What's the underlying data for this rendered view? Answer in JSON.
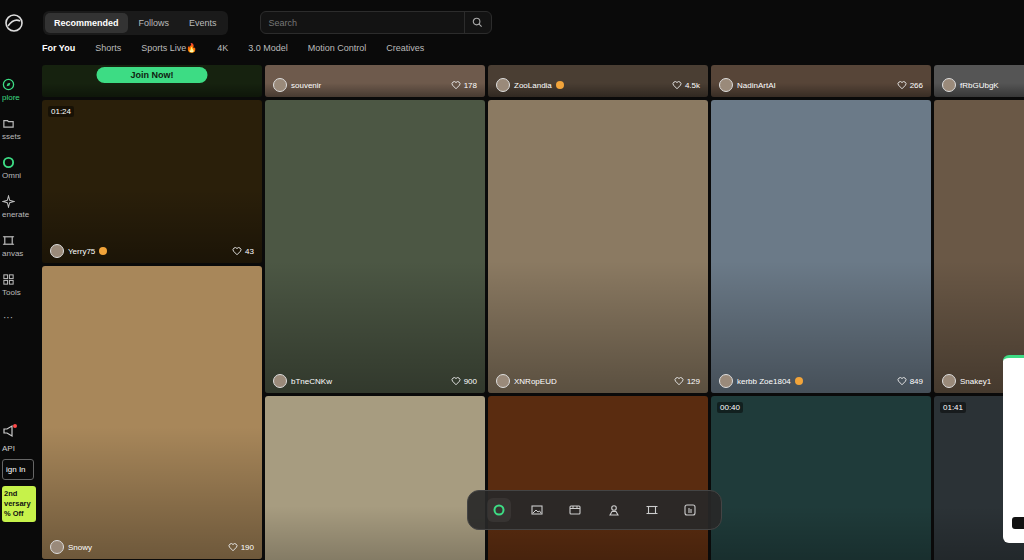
{
  "sidebar": {
    "items": [
      {
        "label": "plore",
        "selected": true
      },
      {
        "label": "ssets",
        "selected": false
      },
      {
        "label": "Omni",
        "selected": false
      },
      {
        "label": "enerate",
        "selected": false
      },
      {
        "label": "anvas",
        "selected": false
      },
      {
        "label": "Tools",
        "selected": false
      }
    ],
    "more": "···",
    "api": "API",
    "sign_in": "ign In",
    "promo": [
      "2nd",
      "versary",
      "% Off"
    ]
  },
  "tabs": [
    {
      "label": "Recommended",
      "selected": true
    },
    {
      "label": "Follows",
      "selected": false
    },
    {
      "label": "Events",
      "selected": false
    }
  ],
  "search": {
    "placeholder": "Search"
  },
  "categories": [
    {
      "label": "For You",
      "selected": true
    },
    {
      "label": "Shorts",
      "selected": false
    },
    {
      "label": "Sports Live🔥",
      "selected": false
    },
    {
      "label": "4K",
      "selected": false
    },
    {
      "label": "3.0 Model",
      "selected": false
    },
    {
      "label": "Motion Control",
      "selected": false
    },
    {
      "label": "Creatives",
      "selected": false
    }
  ],
  "columns": [
    {
      "cards": [
        {
          "kind": "top",
          "color": "#16220f",
          "button": "Join Now!",
          "verified": false
        },
        {
          "kind": "wide",
          "color": "#2a1f0a",
          "duration": "01:24",
          "user": "Yerry75",
          "verified": true,
          "likes": "43"
        },
        {
          "kind": "tall",
          "color": "#a8875a",
          "user": "Snowy",
          "verified": false,
          "likes": "190"
        }
      ]
    },
    {
      "cards": [
        {
          "kind": "top",
          "color": "#6e5a4c",
          "user": "souvenir",
          "verified": false,
          "likes": "178"
        },
        {
          "kind": "tall",
          "color": "#4c5744",
          "user": "bTneCNKw",
          "verified": false,
          "likes": "900"
        },
        {
          "kind": "bottom",
          "color": "#a79c80",
          "verified": false
        }
      ]
    },
    {
      "cards": [
        {
          "kind": "top",
          "color": "#4a3e33",
          "user": "ZooLandia",
          "verified": true,
          "likes": "4.5k"
        },
        {
          "kind": "tall",
          "color": "#8b7a62",
          "user": "XNRopEUD",
          "verified": false,
          "likes": "129"
        },
        {
          "kind": "bottom",
          "color": "#5a2c10",
          "verified": false
        }
      ]
    },
    {
      "cards": [
        {
          "kind": "top",
          "color": "#574538",
          "user": "NadinArtAI",
          "verified": false,
          "likes": "266"
        },
        {
          "kind": "tall",
          "color": "#6b7a88",
          "user": "kerbb Zoe1804",
          "verified": true,
          "likes": "849"
        },
        {
          "kind": "bottom",
          "color": "#1f3b3a",
          "duration": "00:40",
          "verified": false
        }
      ]
    },
    {
      "cards": [
        {
          "kind": "top",
          "color": "#555555",
          "user": "fRbGUbgK",
          "verified": false
        },
        {
          "kind": "tall",
          "color": "#6a5846",
          "user": "Snakey1",
          "verified": false
        },
        {
          "kind": "bottom",
          "color": "#2b3236",
          "duration": "01:41",
          "verified": false
        }
      ]
    }
  ],
  "toolbar": {
    "items": [
      {
        "selected": true
      },
      {
        "selected": false
      },
      {
        "selected": false
      },
      {
        "selected": false
      },
      {
        "selected": false
      },
      {
        "selected": false
      }
    ]
  }
}
